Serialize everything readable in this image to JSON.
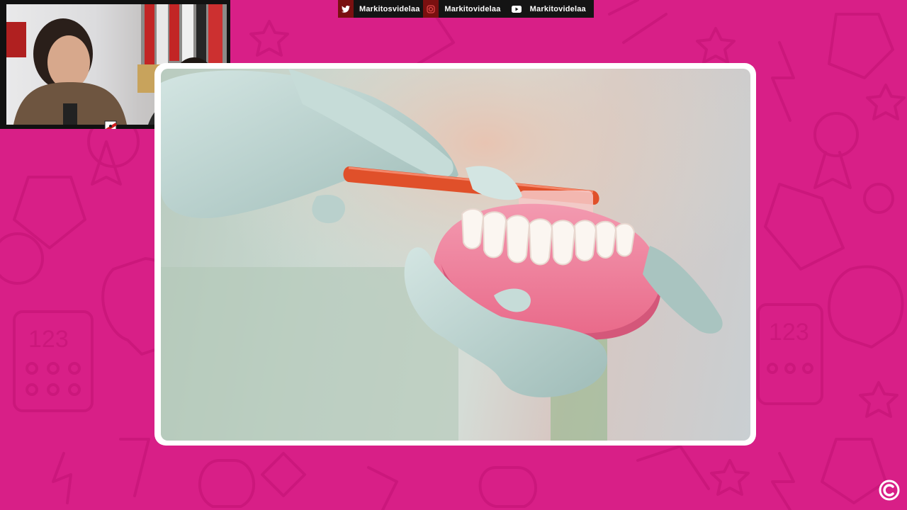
{
  "colors": {
    "background": "#d81f87",
    "social_bar": "#141414",
    "icon_bg": "#7a1010",
    "frame": "#ffffff"
  },
  "social_bar": {
    "items": [
      {
        "icon": "twitter-icon",
        "label": "Markitosvidelaa"
      },
      {
        "icon": "instagram-icon",
        "label": "Markitovidelaa"
      },
      {
        "icon": "youtube-icon",
        "label": "Markitovidelaa"
      }
    ]
  },
  "webcam": {
    "badge_icon": "river-plate-crest-icon"
  },
  "video": {
    "scene": "gloved-hands-brushing-denture-model"
  },
  "overlay": {
    "logo_icon": "channel-c-logo-icon"
  }
}
